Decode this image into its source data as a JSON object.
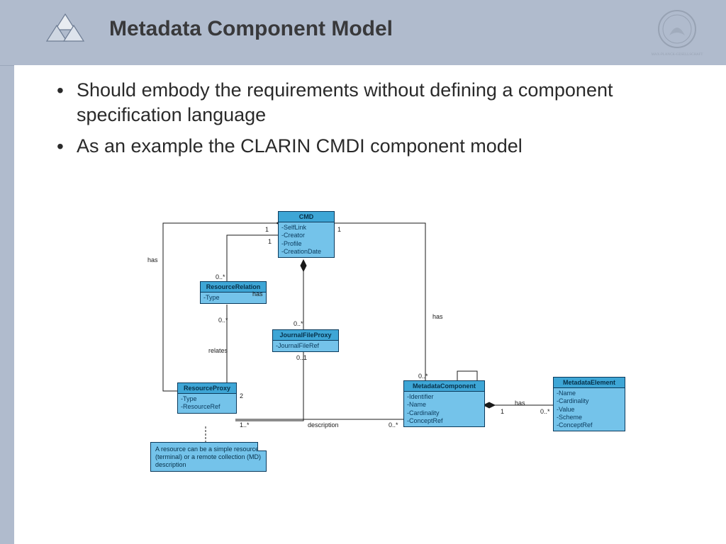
{
  "header": {
    "title": "Metadata Component Model"
  },
  "bullets": [
    "Should embody the requirements without defining a component specification language",
    "As an example the CLARIN CMDI component model"
  ],
  "diagram": {
    "classes": {
      "CMD": {
        "name": "CMD",
        "attrs": [
          "SelfLink",
          "Creator",
          "Profile",
          "CreationDate"
        ]
      },
      "ResourceRelation": {
        "name": "ResourceRelation",
        "attrs": [
          "Type"
        ]
      },
      "JournalFileProxy": {
        "name": "JournalFileProxy",
        "attrs": [
          "JournalFileRef"
        ]
      },
      "ResourceProxy": {
        "name": "ResourceProxy",
        "attrs": [
          "Type",
          "ResourceRef"
        ]
      },
      "MetadataComponent": {
        "name": "MetadataComponent",
        "attrs": [
          "Identifier",
          "Name",
          "Cardinality",
          "ConceptRef"
        ]
      },
      "MetadataElement": {
        "name": "MetadataElement",
        "attrs": [
          "Name",
          "Cardinality",
          "Value",
          "Scheme",
          "ConceptRef"
        ]
      }
    },
    "note": "A resource can be a simple resource (terminal) or a remote collection (MD) description",
    "edge_labels": {
      "has1": "has",
      "has2": "has",
      "has3": "has",
      "has4": "has",
      "relates": "relates",
      "description": "description"
    },
    "mult": {
      "one_a": "1",
      "one_b": "1",
      "one_c": "1",
      "one_d": "1",
      "zero_star_a": "0..*",
      "zero_star_b": "0..*",
      "zero_star_c": "0..*",
      "zero_star_d": "0..*",
      "zero_star_e": "0..*",
      "zero_star_f": "0..*",
      "zero_one": "0..1",
      "one_star": "1..*",
      "two": "2"
    }
  }
}
